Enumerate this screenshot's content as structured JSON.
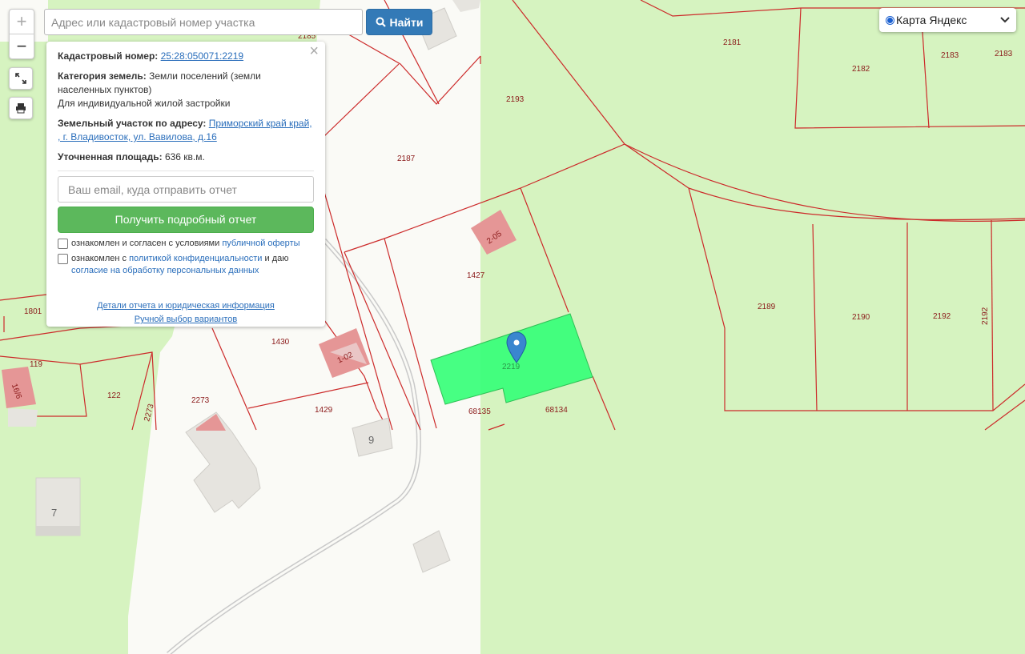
{
  "search": {
    "placeholder": "Адрес или кадастровый номер участка",
    "button_label": "Найти"
  },
  "zoom": {
    "plus": "+",
    "minus": "−"
  },
  "layer": {
    "selected": "Карта Яндекс"
  },
  "panel": {
    "cadastral_label": "Кадастровый номер:",
    "cadastral_value": "25:28:050071:2219",
    "category_label": "Категория земель:",
    "category_value": "Земли поселений (земли населенных пунктов)",
    "usage": "Для индивидуальной жилой застройки",
    "address_label": "Земельный участок по адресу:",
    "address_value": "Приморский край край, , г. Владивосток, ул. Вавилова, д.16",
    "area_label": "Уточненная площадь:",
    "area_value": "636 кв.м.",
    "email_placeholder": "Ваш email, куда отправить отчет",
    "report_button": "Получить подробный отчет",
    "check1_text": "ознакомлен и согласен с условиями",
    "check1_link": "публичной оферты",
    "check2_text": "ознакомлен с",
    "check2_link": "политикой конфиденциальности",
    "check2_text2": "и даю",
    "check2_link2": "согласие на обработку персональных данных",
    "link_details": "Детали отчета и юридическая информация",
    "link_manual": "Ручной выбор вариантов"
  },
  "map": {
    "parcel_labels": [
      "2185",
      "2181",
      "2182",
      "2183",
      "2183",
      "2193",
      "2187",
      "1427",
      "2189",
      "2190",
      "2192",
      "2192",
      "1430",
      "1429",
      "2273",
      "2273",
      "122",
      "119",
      "1801",
      "68135",
      "68134",
      "2219"
    ],
    "building_labels": [
      "2-05",
      "1-02",
      "16/6",
      "9",
      "7"
    ],
    "colors": {
      "selected_parcel": "#33ff77",
      "boundary": "#cc2a2a",
      "land": "#d6f3c0",
      "road": "#fafaf6"
    }
  }
}
